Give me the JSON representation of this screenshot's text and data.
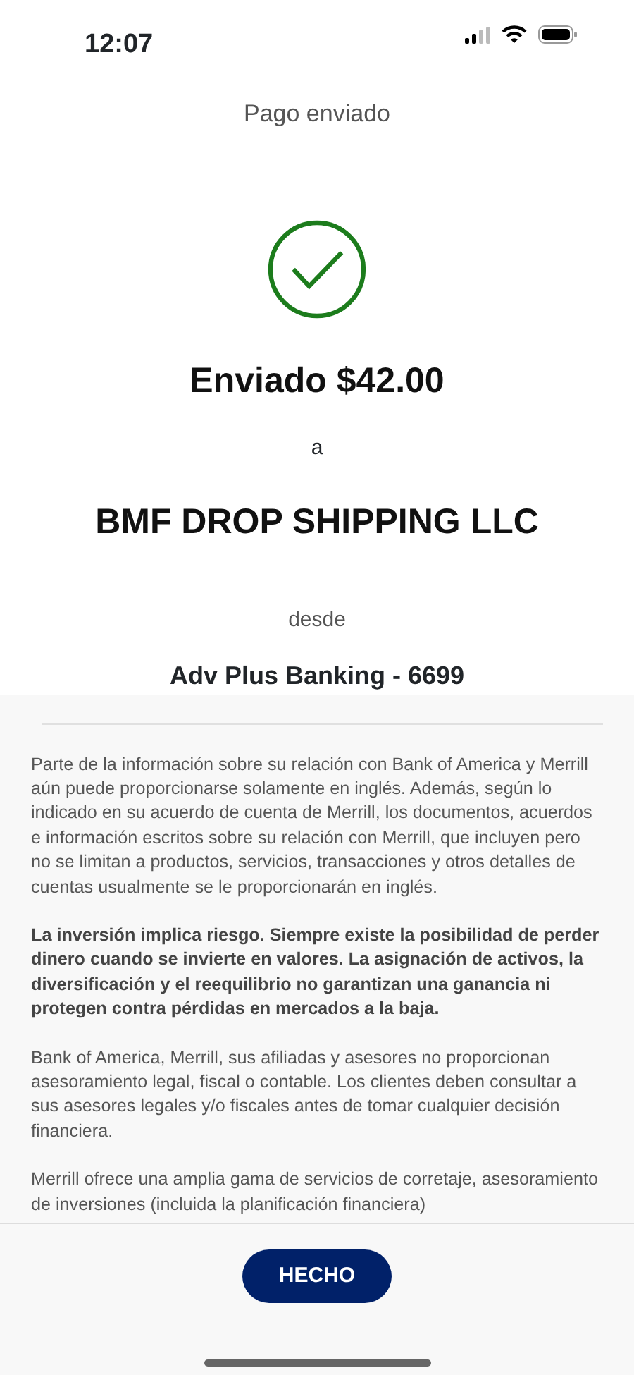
{
  "status_bar": {
    "time": "12:07"
  },
  "header": {
    "title": "Pago enviado"
  },
  "confirmation": {
    "amount_line": "Enviado $42.00",
    "connector": "a",
    "recipient": "BMF DROP SHIPPING LLC",
    "from_label": "desde",
    "account": "Adv Plus Banking - 6699"
  },
  "disclosures": [
    {
      "text": "Parte de la información sobre su relación con Bank of America y Merrill aún puede proporcionarse solamente en inglés. Además, según lo indicado en su acuerdo de cuenta de Merrill, los documentos, acuerdos e información escritos sobre su relación con Merrill, que incluyen pero no se limitan a productos, servicios, transacciones y otros detalles de cuentas usualmente se le proporcionarán en inglés.",
      "bold": false
    },
    {
      "text": "La inversión implica riesgo. Siempre existe la posibilidad de perder dinero cuando se invierte en valores. La asignación de activos, la diversificación y el reequilibrio no garantizan una ganancia ni protegen contra pérdidas en mercados a la baja.",
      "bold": true
    },
    {
      "text": "Bank of America, Merrill, sus afiliadas y asesores no proporcionan asesoramiento legal, fiscal o contable. Los clientes deben consultar a sus asesores legales y/o fiscales antes de tomar cualquier decisión financiera.",
      "bold": false
    },
    {
      "text": "Merrill ofrece una amplia gama de servicios de corretaje, asesoramiento de inversiones (incluida la planificación financiera)",
      "bold": false
    }
  ],
  "done_button": {
    "label": "HECHO"
  }
}
